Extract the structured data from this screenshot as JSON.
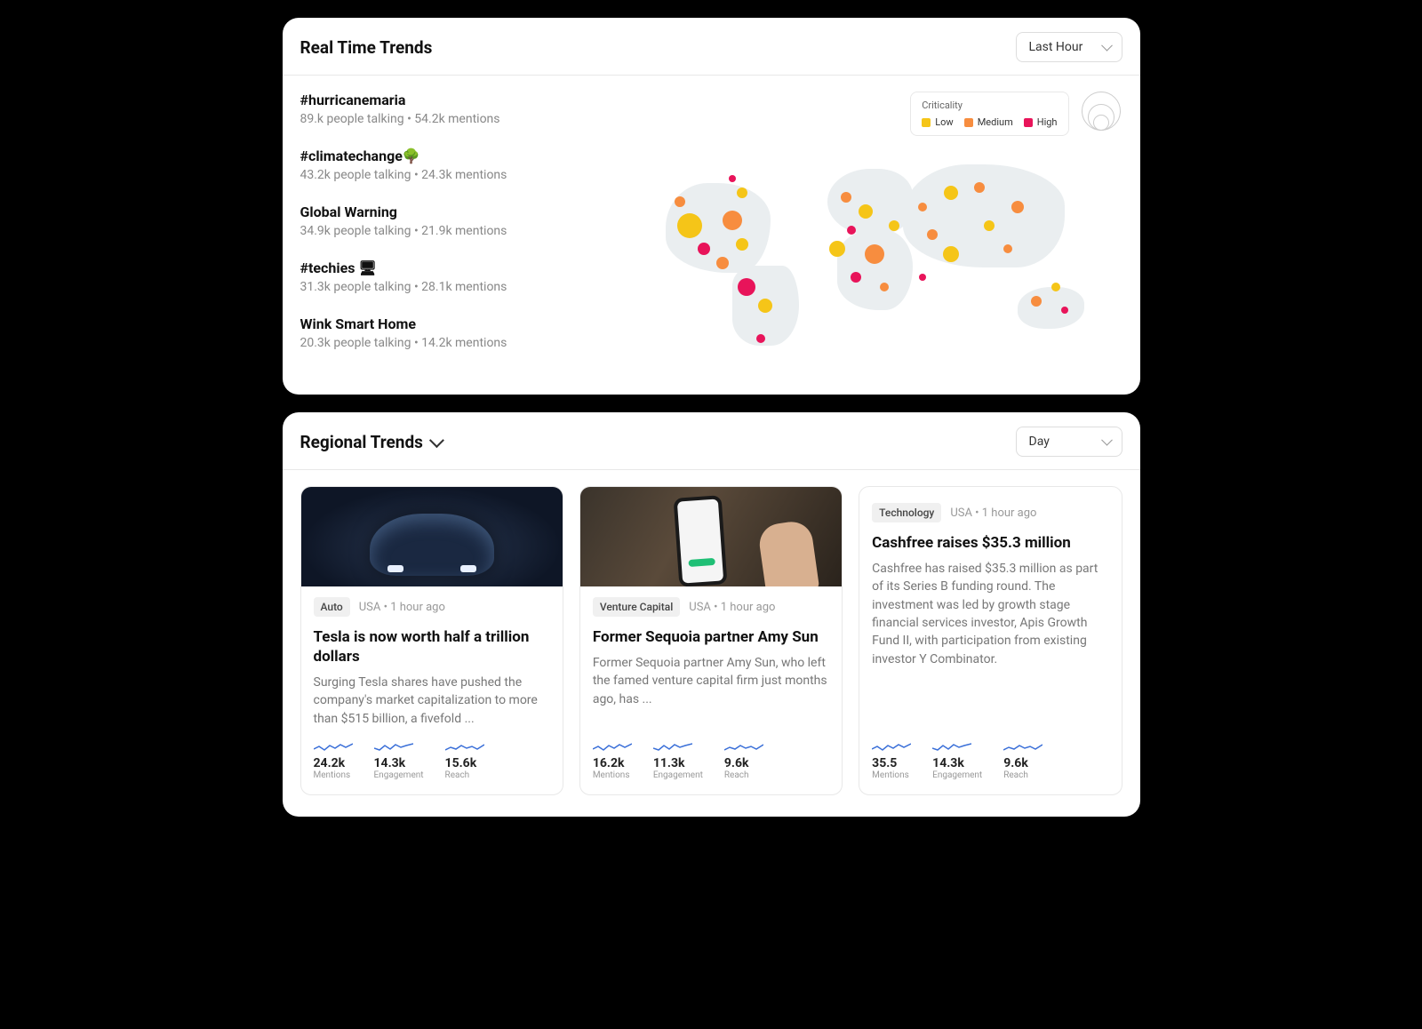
{
  "realtime": {
    "title": "Real Time Trends",
    "range": "Last Hour",
    "legend": {
      "title": "Criticality",
      "low": "Low",
      "medium": "Medium",
      "high": "High"
    },
    "trends": [
      {
        "name": "#hurricanemaria",
        "meta": "89.k people talking • 54.2k mentions"
      },
      {
        "name": "#climatechange🌳",
        "meta": "43.2k people talking • 24.3k mentions"
      },
      {
        "name": "Global Warning",
        "meta": "34.9k people talking • 21.9k mentions"
      },
      {
        "name": "#techies 🖥",
        "meta": "31.3k people talking • 28.1k mentions"
      },
      {
        "name": "Wink Smart Home",
        "meta": "20.3k people talking • 14.2k mentions"
      }
    ]
  },
  "regional": {
    "title": "Regional Trends",
    "range": "Day",
    "stat_labels": {
      "mentions": "Mentions",
      "engagement": "Engagement",
      "reach": "Reach"
    },
    "articles": [
      {
        "tag": "Auto",
        "meta": "USA • 1 hour ago",
        "title": "Tesla is now worth half a trillion dollars",
        "desc": "Surging Tesla shares have pushed the company's market capitalization to more than $515 billion, a fivefold ...",
        "mentions": "24.2k",
        "engagement": "14.3k",
        "reach": "15.6k"
      },
      {
        "tag": "Venture Capital",
        "meta": "USA • 1 hour ago",
        "title": "Former Sequoia partner Amy Sun",
        "desc": "Former Sequoia partner Amy Sun, who left the famed venture capital firm just months ago, has ...",
        "mentions": "16.2k",
        "engagement": "11.3k",
        "reach": "9.6k"
      },
      {
        "tag": "Technology",
        "meta": "USA • 1 hour ago",
        "title": "Cashfree raises $35.3 million",
        "desc": "Cashfree has raised $35.3 million as part of its Series B funding round. The investment was led by growth stage financial services investor, Apis Growth Fund II, with participation from existing investor Y Combinator.",
        "mentions": "35.5",
        "engagement": "14.3k",
        "reach": "9.6k"
      }
    ]
  },
  "colors": {
    "low": "#f5c518",
    "medium": "#f78d3f",
    "high": "#e8145a",
    "spark": "#3a6fd8"
  }
}
